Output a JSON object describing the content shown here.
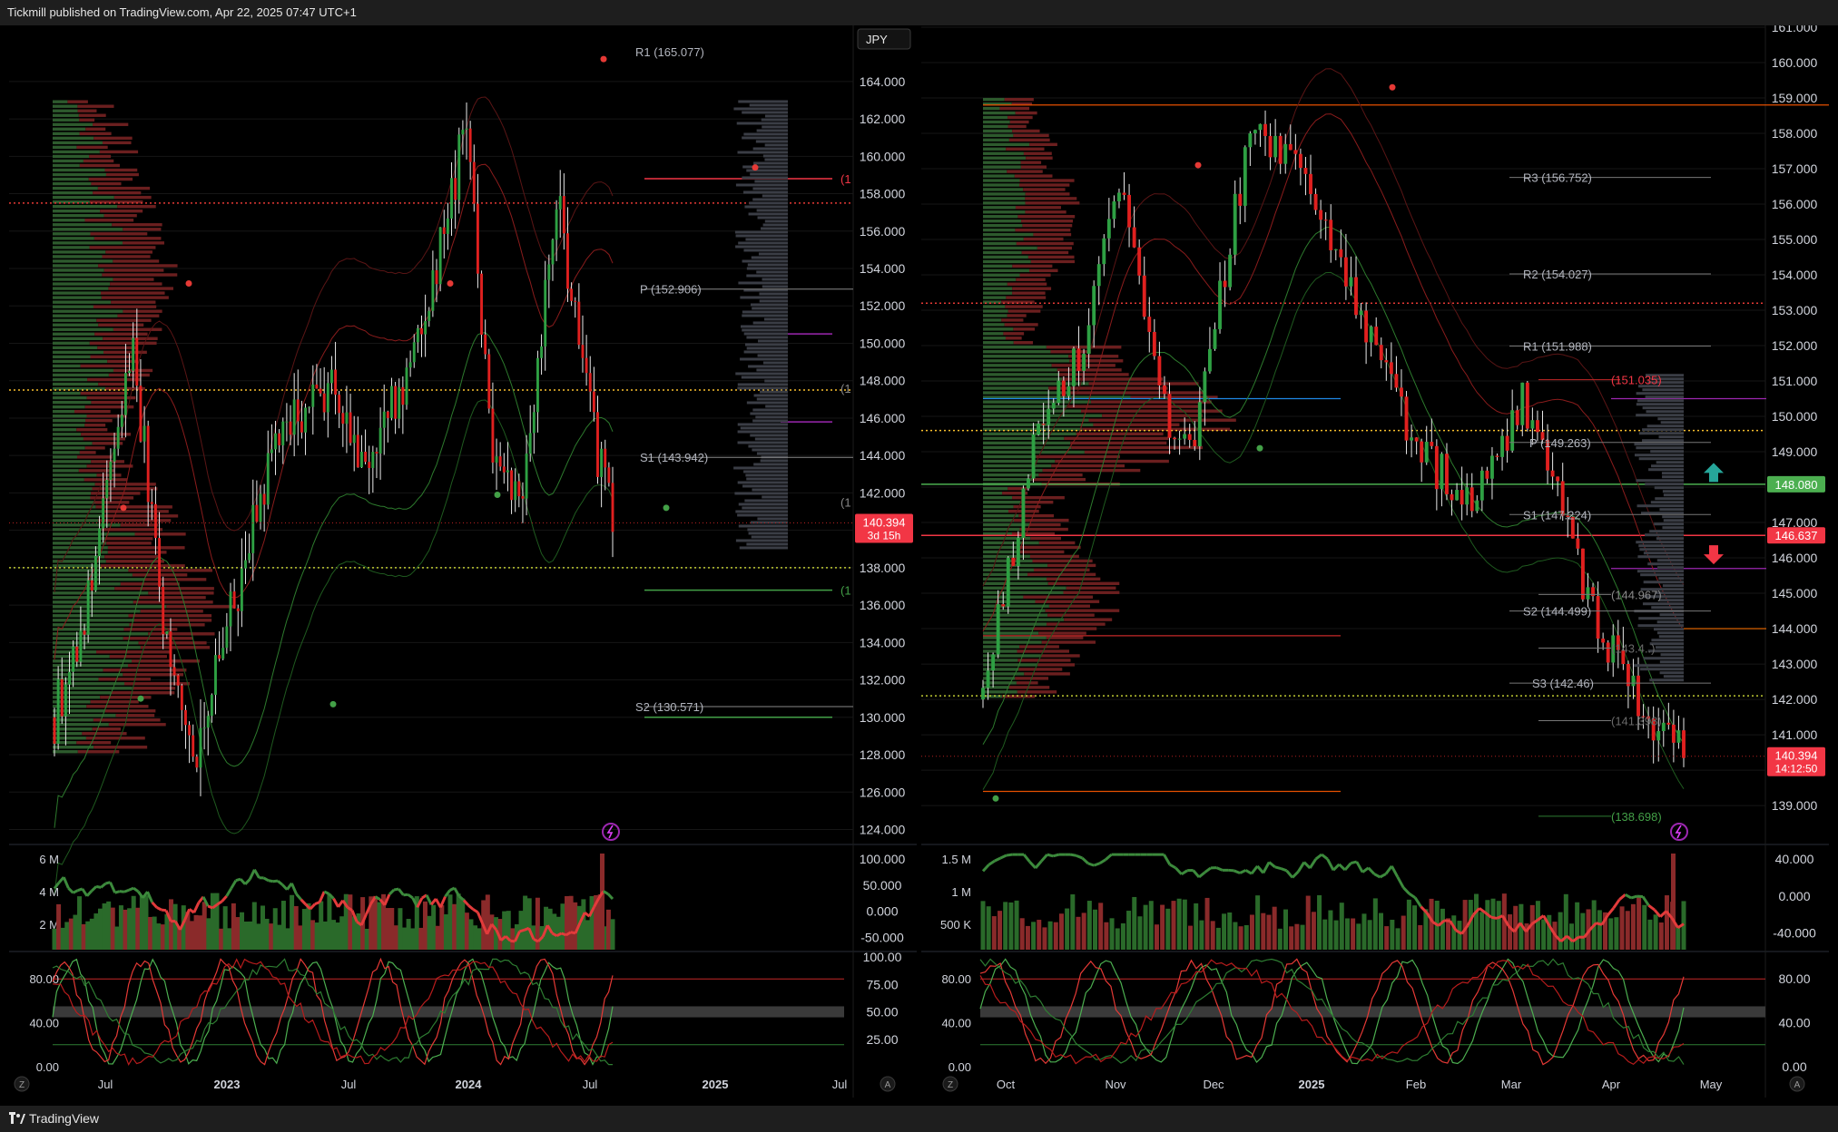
{
  "header": {
    "published": "Tickmill published on TradingView.com, Apr 22, 2025 07:47 UTC+1"
  },
  "footer": {
    "brand": "TradingView"
  },
  "colors": {
    "up": "#2ea043",
    "down": "#e0201f",
    "bg": "#000000",
    "grid": "#161616",
    "pivot": "#b0b0b0",
    "price_tag": "#f23645",
    "green_tag": "#4caf50"
  },
  "chart_data": [
    {
      "type": "candlestick",
      "panel": "left",
      "currency_button": "JPY",
      "y_axis_ticks": [
        "164.000",
        "162.000",
        "160.000",
        "158.000",
        "156.000",
        "154.000",
        "152.000",
        "150.000",
        "148.000",
        "146.000",
        "144.000",
        "142.000",
        "140.000",
        "138.000",
        "136.000",
        "134.000",
        "132.000",
        "130.000",
        "128.000",
        "126.000",
        "124.000"
      ],
      "ylim": [
        123.2,
        167.0
      ],
      "x_ticks": [
        {
          "label": "Jul",
          "bold": false
        },
        {
          "label": "2023",
          "bold": true
        },
        {
          "label": "Jul",
          "bold": false
        },
        {
          "label": "2024",
          "bold": true
        },
        {
          "label": "Jul",
          "bold": false
        },
        {
          "label": "2025",
          "bold": true
        },
        {
          "label": "Jul",
          "bold": false
        }
      ],
      "pivot_labels": [
        {
          "text": "R1 (165.077)",
          "value": 165.6
        },
        {
          "text": "P (152.906)",
          "value": 152.9
        },
        {
          "text": "S1 (143.942)",
          "value": 143.9
        },
        {
          "text": "S2 (130.571)",
          "value": 130.57
        }
      ],
      "price_tag": {
        "value": 140.394,
        "price": "140.394",
        "countdown": "3d 15h"
      },
      "line_stubs": [
        "(1",
        "(1",
        "(1",
        "(1"
      ],
      "volume_pane": {
        "left_ticks": [
          "6 M",
          "4 M",
          "2 M"
        ],
        "right_ticks": [
          "100.000",
          "50.000",
          "0.000",
          "-50.000"
        ]
      },
      "oscillator_pane": {
        "left_ticks": [
          "80.00",
          "40.00",
          "0.00"
        ],
        "right_ticks": [
          "100.00",
          "75.00",
          "50.00",
          "25.00"
        ]
      },
      "axis_buttons": [
        "Z",
        "A"
      ]
    },
    {
      "type": "candlestick",
      "panel": "right",
      "y_axis_ticks": [
        "161.000",
        "160.000",
        "159.000",
        "158.000",
        "157.000",
        "156.000",
        "155.000",
        "154.000",
        "153.000",
        "152.000",
        "151.000",
        "150.000",
        "149.000",
        "148.000",
        "147.000",
        "146.000",
        "145.000",
        "144.000",
        "143.000",
        "142.000",
        "141.000",
        "140.000",
        "139.000"
      ],
      "ylim": [
        137.9,
        161.05
      ],
      "x_ticks": [
        {
          "label": "Oct",
          "bold": false
        },
        {
          "label": "Nov",
          "bold": false
        },
        {
          "label": "Dec",
          "bold": false
        },
        {
          "label": "2025",
          "bold": true
        },
        {
          "label": "Feb",
          "bold": false
        },
        {
          "label": "Mar",
          "bold": false
        },
        {
          "label": "Apr",
          "bold": false
        },
        {
          "label": "May",
          "bold": false
        }
      ],
      "pivot_labels": [
        {
          "text": "R3 (156.752)",
          "value": 156.752
        },
        {
          "text": "R2 (154.027)",
          "value": 154.027
        },
        {
          "text": "R1 (151.988)",
          "value": 151.988
        },
        {
          "text": "(151.035)",
          "value": 151.035
        },
        {
          "text": "P (149.263)",
          "value": 149.263
        },
        {
          "text": "S1 (147.224)",
          "value": 147.224
        },
        {
          "text": "(144.967)",
          "value": 144.967
        },
        {
          "text": "S2 (144.499)",
          "value": 144.499
        },
        {
          "text": "(143.4..)",
          "value": 143.45
        },
        {
          "text": "S3 (142.46)",
          "value": 142.46
        },
        {
          "text": "(141.398)",
          "value": 141.398
        },
        {
          "text": "(138.698)",
          "value": 138.698
        }
      ],
      "level_tags": [
        {
          "price": "148.080",
          "value": 148.08,
          "color": "#4caf50"
        },
        {
          "price": "146.637",
          "value": 146.637,
          "color": "#f23645"
        }
      ],
      "price_tag": {
        "value": 140.394,
        "price": "140.394",
        "countdown": "14:12:50"
      },
      "volume_pane": {
        "left_ticks": [
          "1.5 M",
          "1 M",
          "500 K"
        ],
        "right_ticks": [
          "40.000",
          "0.000",
          "-40.000"
        ]
      },
      "oscillator_pane": {
        "left_ticks": [
          "80.00",
          "40.00",
          "0.00"
        ],
        "right_ticks": [
          "80.00",
          "40.00",
          "0.00"
        ]
      },
      "axis_buttons": [
        "Z",
        "A"
      ]
    }
  ]
}
